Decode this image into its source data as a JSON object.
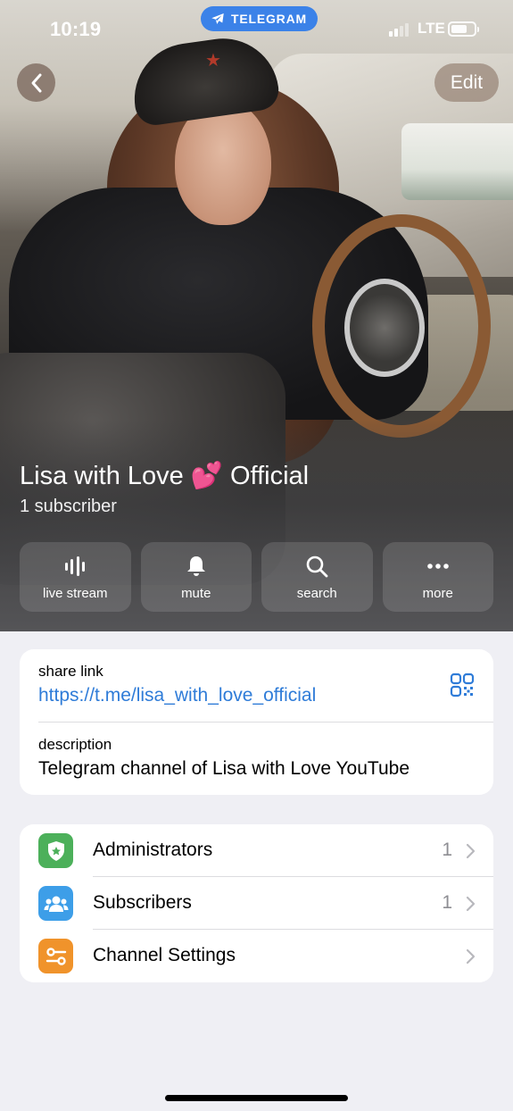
{
  "status_bar": {
    "time": "10:19",
    "app_pill": "TELEGRAM",
    "network": "LTE"
  },
  "nav": {
    "back_icon": "chevron-left-icon",
    "edit_label": "Edit"
  },
  "channel": {
    "name": "Lisa with Love 💕 Official",
    "subscribers": "1 subscriber"
  },
  "actions": [
    {
      "label": "live stream",
      "icon": "live-stream-icon"
    },
    {
      "label": "mute",
      "icon": "bell-icon"
    },
    {
      "label": "search",
      "icon": "search-icon"
    },
    {
      "label": "more",
      "icon": "more-icon"
    }
  ],
  "info": {
    "share_link_label": "share link",
    "share_link": "https://t.me/lisa_with_love_official",
    "description_label": "description",
    "description": "Telegram channel of Lisa with Love YouTube"
  },
  "menu": [
    {
      "title": "Administrators",
      "count": "1",
      "icon": "admin-shield-icon",
      "color": "#4cb05a"
    },
    {
      "title": "Subscribers",
      "count": "1",
      "icon": "subscribers-icon",
      "color": "#3d9ee8"
    },
    {
      "title": "Channel Settings",
      "count": "",
      "icon": "settings-sliders-icon",
      "color": "#f0932b"
    }
  ],
  "colors": {
    "link": "#2f7cd8",
    "telegram_pill": "#3b82e8",
    "background": "#efeff4"
  }
}
